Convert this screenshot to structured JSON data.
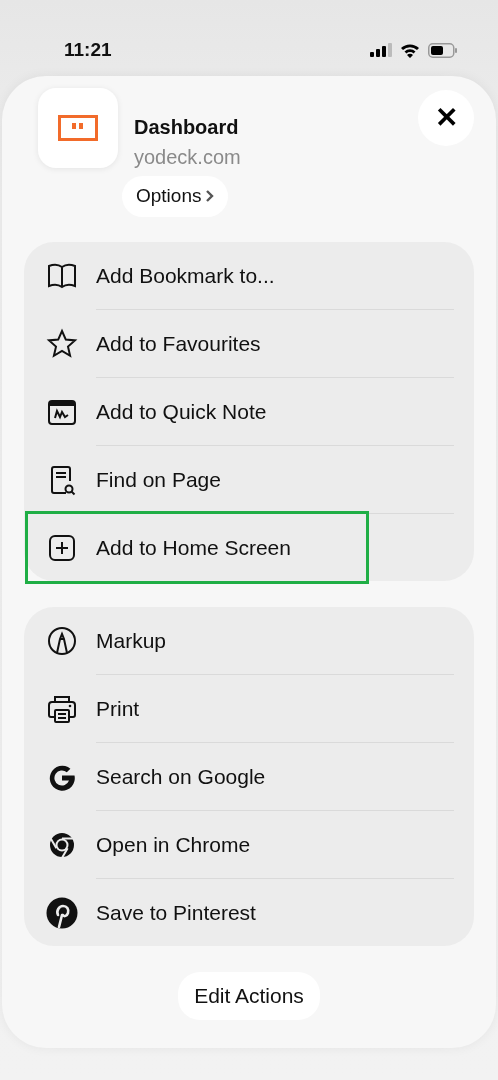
{
  "status_bar": {
    "time": "11:21"
  },
  "header": {
    "title": "Dashboard",
    "domain": "yodeck.com",
    "options_button": "Options",
    "close_button": "✕"
  },
  "groups": [
    {
      "items": [
        {
          "label": "Add Bookmark to...",
          "highlighted": false
        },
        {
          "label": "Add to Favourites",
          "highlighted": false
        },
        {
          "label": "Add to Quick Note",
          "highlighted": false
        },
        {
          "label": "Find on Page",
          "highlighted": false
        },
        {
          "label": "Add to Home Screen",
          "highlighted": true
        }
      ]
    },
    {
      "items": [
        {
          "label": "Markup",
          "highlighted": false
        },
        {
          "label": "Print",
          "highlighted": false
        },
        {
          "label": "Search on Google",
          "highlighted": false
        },
        {
          "label": "Open in Chrome",
          "highlighted": false
        },
        {
          "label": "Save to Pinterest",
          "highlighted": false
        }
      ]
    }
  ],
  "edit_button": "Edit Actions"
}
